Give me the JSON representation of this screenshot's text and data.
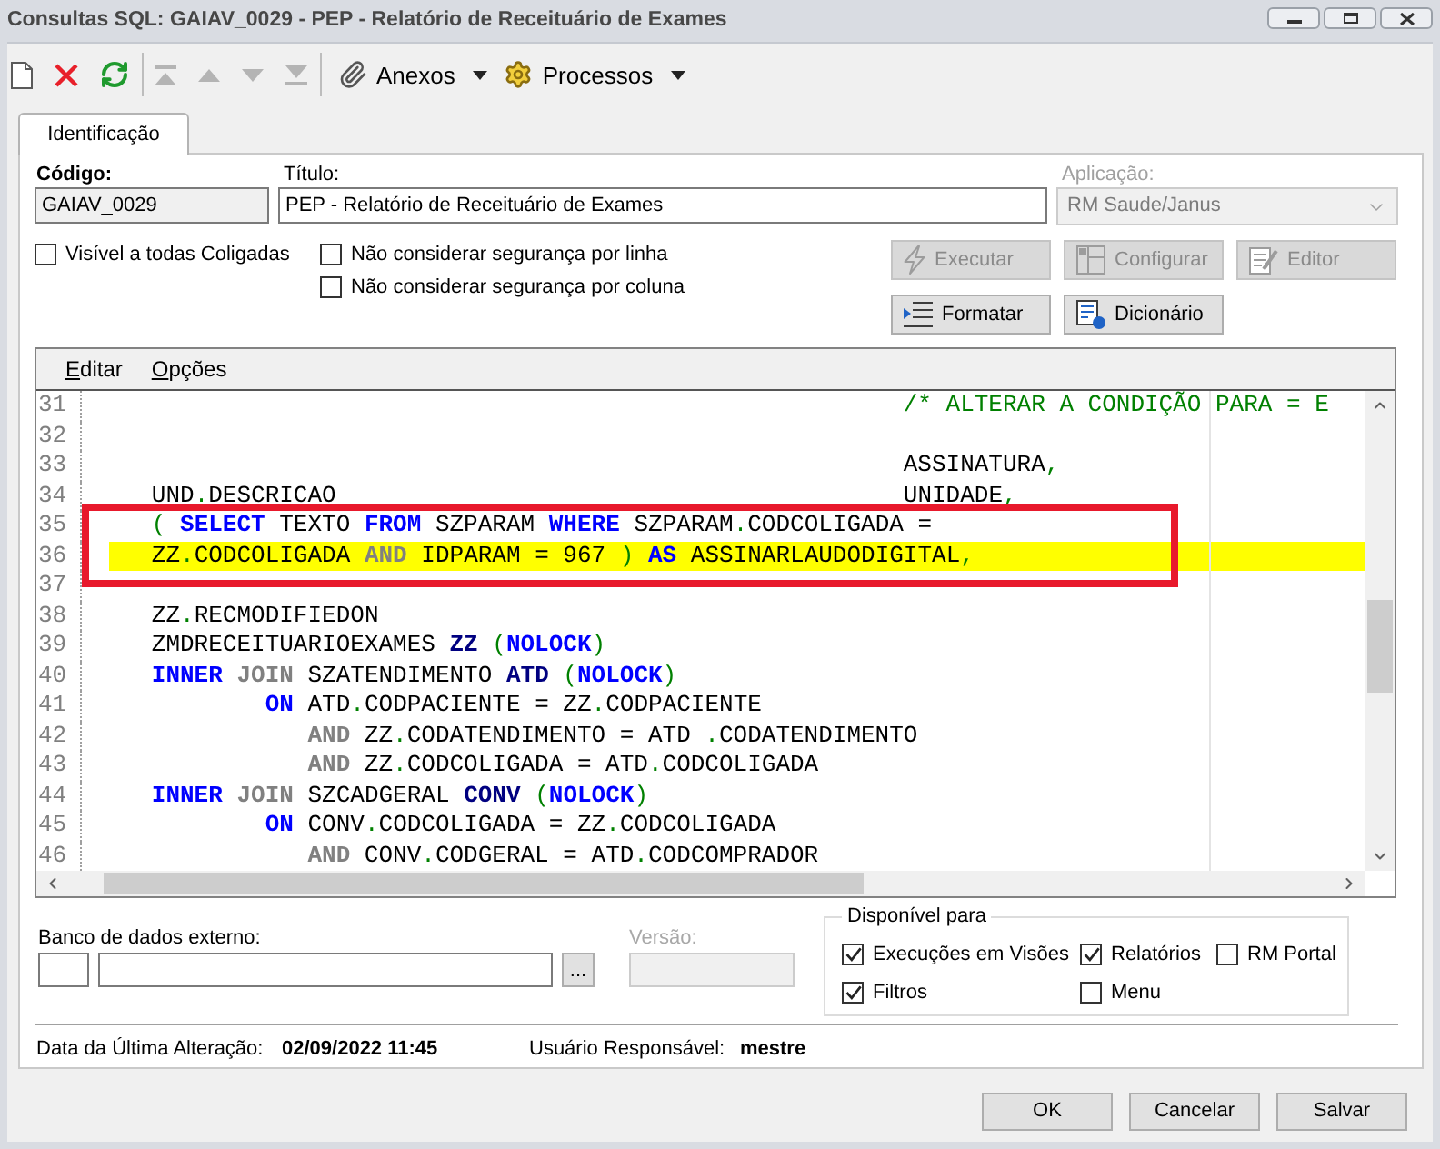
{
  "window": {
    "title": "Consultas SQL: GAIAV_0029 - PEP - Relatório de Receituário de Exames"
  },
  "toolbar": {
    "groups": [
      [
        {
          "kind": "new",
          "disabled": false
        },
        {
          "kind": "delete",
          "disabled": false
        },
        {
          "kind": "refresh",
          "disabled": false
        }
      ],
      [
        {
          "kind": "first",
          "disabled": true
        },
        {
          "kind": "previous",
          "disabled": true
        },
        {
          "kind": "next",
          "disabled": true
        },
        {
          "kind": "last",
          "disabled": true
        }
      ]
    ],
    "menus": [
      {
        "kind": "attachments",
        "label": "Anexos"
      },
      {
        "kind": "processes",
        "label": "Processos"
      }
    ]
  },
  "tabs": [
    {
      "label": "Identificação",
      "selected": true
    }
  ],
  "form": {
    "code": {
      "label": "Código:",
      "value": "GAIAV_0029",
      "readonly": true
    },
    "title": {
      "label": "Título:",
      "value": "PEP - Relatório de Receituário de Exames",
      "readonly": false
    },
    "application": {
      "label": "Aplicação:",
      "value": "RM Saude/Janus",
      "disabled": true
    },
    "options": [
      {
        "label": "Visível a todas Coligadas",
        "checked": false
      },
      {
        "label": "Não considerar segurança por linha",
        "checked": false
      },
      {
        "label": "Não considerar segurança por coluna",
        "checked": false
      }
    ],
    "buttons": [
      {
        "kind": "execute",
        "label": "Executar",
        "disabled": true
      },
      {
        "kind": "configure",
        "label": "Configurar",
        "disabled": true
      },
      {
        "kind": "editor",
        "label": "Editor",
        "disabled": true
      },
      {
        "kind": "format",
        "label": "Formatar",
        "disabled": false
      },
      {
        "kind": "dictionary",
        "label": "Dicionário",
        "disabled": false
      }
    ]
  },
  "editor": {
    "menu": [
      "Editar",
      "Opções"
    ],
    "lines": [
      {
        "number": "31",
        "current": false,
        "marked": false,
        "tokens": [
          {
            "kind": "comment",
            "text": "                                                        /* ALTERAR A CONDIÇÃO PARA = E"
          }
        ]
      },
      {
        "number": "32",
        "current": false,
        "marked": false
      },
      {
        "number": "33",
        "current": false,
        "marked": false,
        "tokens": [
          {
            "kind": "ident",
            "text": "                                                        ASSINATURA"
          },
          {
            "kind": "punct",
            "text": ","
          }
        ]
      },
      {
        "number": "34",
        "current": false,
        "marked": false,
        "tokens": [
          {
            "kind": "ident",
            "text": "   UND"
          },
          {
            "kind": "punct",
            "text": "."
          },
          {
            "kind": "ident",
            "text": "DESCRICAO                                        UNIDADE"
          },
          {
            "kind": "punct",
            "text": ","
          }
        ]
      },
      {
        "number": "35",
        "current": false,
        "marked": true,
        "tokens": [
          {
            "kind": "punct",
            "text": "   ("
          },
          {
            "kind": "keyword",
            "text": " SELECT"
          },
          {
            "kind": "ident",
            "text": " TEXTO "
          },
          {
            "kind": "keyword",
            "text": "FROM"
          },
          {
            "kind": "ident",
            "text": " SZPARAM "
          },
          {
            "kind": "keyword",
            "text": "WHERE"
          },
          {
            "kind": "ident",
            "text": " SZPARAM"
          },
          {
            "kind": "punct",
            "text": "."
          },
          {
            "kind": "ident",
            "text": "CODCOLIGADA ="
          }
        ]
      },
      {
        "number": "36",
        "current": true,
        "marked": true,
        "tokens": [
          {
            "kind": "ident",
            "text": "   ZZ"
          },
          {
            "kind": "punct",
            "text": "."
          },
          {
            "kind": "ident",
            "text": "CODCOLIGADA "
          },
          {
            "kind": "operator",
            "text": "AND"
          },
          {
            "kind": "ident",
            "text": " IDPARAM = 967 "
          },
          {
            "kind": "punct",
            "text": ")"
          },
          {
            "kind": "keyword",
            "text": " AS"
          },
          {
            "kind": "ident",
            "text": " ASSINARLAUDODIGITAL"
          },
          {
            "kind": "punct",
            "text": ","
          }
        ]
      },
      {
        "number": "37",
        "current": false,
        "marked": false
      },
      {
        "number": "38",
        "current": false,
        "marked": false,
        "tokens": [
          {
            "kind": "ident",
            "text": "   ZZ"
          },
          {
            "kind": "punct",
            "text": "."
          },
          {
            "kind": "ident",
            "text": "RECMODIFIEDON"
          }
        ]
      },
      {
        "number": "39",
        "current": false,
        "marked": false,
        "tokens": [
          {
            "kind": "ident",
            "text": "   ZMDRECEITUARIOEXAMES "
          },
          {
            "kind": "alias",
            "text": "ZZ"
          },
          {
            "kind": "punct",
            "text": " ("
          },
          {
            "kind": "keyword",
            "text": "NOLOCK"
          },
          {
            "kind": "punct",
            "text": ")"
          }
        ]
      },
      {
        "number": "40",
        "current": false,
        "marked": false,
        "tokens": [
          {
            "kind": "keyword",
            "text": "   INNER"
          },
          {
            "kind": "operator",
            "text": " JOIN"
          },
          {
            "kind": "ident",
            "text": " SZATENDIMENTO "
          },
          {
            "kind": "alias",
            "text": "ATD"
          },
          {
            "kind": "punct",
            "text": " ("
          },
          {
            "kind": "keyword",
            "text": "NOLOCK"
          },
          {
            "kind": "punct",
            "text": ")"
          }
        ]
      },
      {
        "number": "41",
        "current": false,
        "marked": false,
        "tokens": [
          {
            "kind": "keyword",
            "text": "           ON"
          },
          {
            "kind": "ident",
            "text": " ATD"
          },
          {
            "kind": "punct",
            "text": "."
          },
          {
            "kind": "ident",
            "text": "CODPACIENTE = ZZ"
          },
          {
            "kind": "punct",
            "text": "."
          },
          {
            "kind": "ident",
            "text": "CODPACIENTE"
          }
        ]
      },
      {
        "number": "42",
        "current": false,
        "marked": false,
        "tokens": [
          {
            "kind": "operator",
            "text": "              AND"
          },
          {
            "kind": "ident",
            "text": " ZZ"
          },
          {
            "kind": "punct",
            "text": "."
          },
          {
            "kind": "ident",
            "text": "CODATENDIMENTO = ATD "
          },
          {
            "kind": "punct",
            "text": "."
          },
          {
            "kind": "ident",
            "text": "CODATENDIMENTO"
          }
        ]
      },
      {
        "number": "43",
        "current": false,
        "marked": false,
        "tokens": [
          {
            "kind": "operator",
            "text": "              AND"
          },
          {
            "kind": "ident",
            "text": " ZZ"
          },
          {
            "kind": "punct",
            "text": "."
          },
          {
            "kind": "ident",
            "text": "CODCOLIGADA = ATD"
          },
          {
            "kind": "punct",
            "text": "."
          },
          {
            "kind": "ident",
            "text": "CODCOLIGADA"
          }
        ]
      },
      {
        "number": "44",
        "current": false,
        "marked": false,
        "tokens": [
          {
            "kind": "keyword",
            "text": "   INNER"
          },
          {
            "kind": "operator",
            "text": " JOIN"
          },
          {
            "kind": "ident",
            "text": " SZCADGERAL "
          },
          {
            "kind": "alias",
            "text": "CONV"
          },
          {
            "kind": "punct",
            "text": " ("
          },
          {
            "kind": "keyword",
            "text": "NOLOCK"
          },
          {
            "kind": "punct",
            "text": ")"
          }
        ]
      },
      {
        "number": "45",
        "current": false,
        "marked": false,
        "tokens": [
          {
            "kind": "keyword",
            "text": "           ON"
          },
          {
            "kind": "ident",
            "text": " CONV"
          },
          {
            "kind": "punct",
            "text": "."
          },
          {
            "kind": "ident",
            "text": "CODCOLIGADA = ZZ"
          },
          {
            "kind": "punct",
            "text": "."
          },
          {
            "kind": "ident",
            "text": "CODCOLIGADA"
          }
        ]
      },
      {
        "number": "46",
        "current": false,
        "marked": false,
        "tokens": [
          {
            "kind": "operator",
            "text": "              AND"
          },
          {
            "kind": "ident",
            "text": " CONV"
          },
          {
            "kind": "punct",
            "text": "."
          },
          {
            "kind": "ident",
            "text": "CODGERAL = ATD"
          },
          {
            "kind": "punct",
            "text": "."
          },
          {
            "kind": "ident",
            "text": "CODCOMPRADOR"
          }
        ]
      }
    ]
  },
  "external_db": {
    "label": "Banco de dados externo:",
    "browse_button": "..."
  },
  "version": {
    "label": "Versão:",
    "disabled": true
  },
  "available_for": {
    "title": "Disponível para",
    "options": [
      {
        "label": "Execuções em Visões",
        "checked": true
      },
      {
        "label": "Relatórios",
        "checked": true
      },
      {
        "label": "RM Portal",
        "checked": false
      },
      {
        "label": "Filtros",
        "checked": true
      },
      {
        "label": "Menu",
        "checked": false
      }
    ]
  },
  "info": [
    {
      "label": "Data da Última Alteração:",
      "value": "02/09/2022 11:45"
    },
    {
      "label": "Usuário Responsável:",
      "value": "mestre"
    }
  ],
  "dialog_buttons": [
    "OK",
    "Cancelar",
    "Salvar"
  ]
}
